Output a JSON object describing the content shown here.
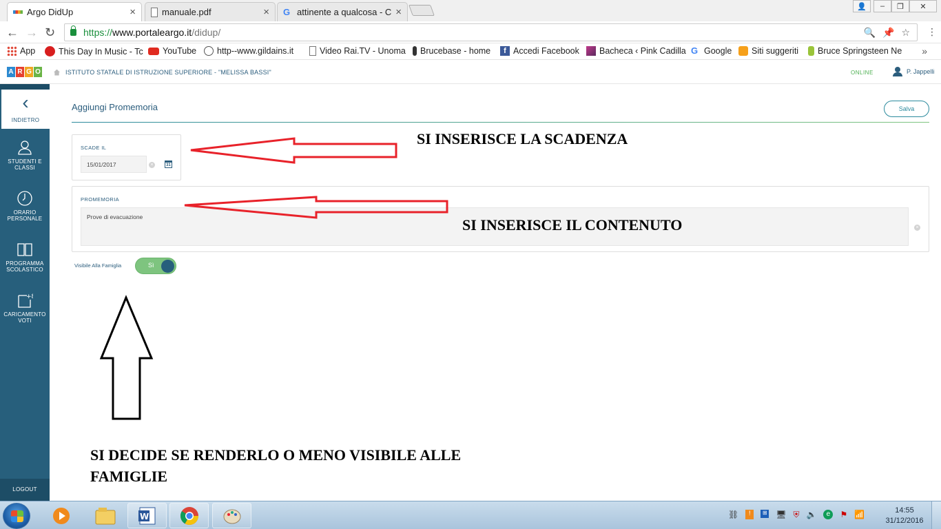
{
  "browser": {
    "tabs": [
      {
        "title": "Argo DidUp",
        "close": "×",
        "active": true
      },
      {
        "title": "manuale.pdf",
        "close": "×",
        "active": false
      },
      {
        "title": "attinente a qualcosa - Ce",
        "close": "×",
        "active": false
      }
    ],
    "url": {
      "protocol": "https://",
      "host": "www.portaleargo.it",
      "path": "/didup/"
    },
    "window_controls": [
      "–",
      "❐",
      "✕"
    ]
  },
  "bookmarks": [
    {
      "label": "App",
      "icon": "apps-grid-icon"
    },
    {
      "label": "This Day In Music - Tc",
      "icon": "red-circle-icon"
    },
    {
      "label": "YouTube",
      "icon": "youtube-icon"
    },
    {
      "label": "http--www.gildains.it",
      "icon": "gildains-icon"
    },
    {
      "label": "Video Rai.TV - Unoma",
      "icon": "page-icon"
    },
    {
      "label": "Brucebase - home",
      "icon": "guitarist-icon"
    },
    {
      "label": "Accedi  Facebook",
      "icon": "facebook-icon"
    },
    {
      "label": "Bacheca ‹ Pink Cadilla",
      "icon": "pink-icon"
    },
    {
      "label": "Google",
      "icon": "google-icon"
    },
    {
      "label": "Siti suggeriti",
      "icon": "suggested-icon"
    },
    {
      "label": "Bruce Springsteen  Ne",
      "icon": "springsteen-icon"
    }
  ],
  "bookmarks_more": "»",
  "app": {
    "logo": [
      "A",
      "R",
      "G",
      "O"
    ],
    "school": "ISTITUTO STATALE DI ISTRUZIONE SUPERIORE - \"MELISSA BASSI\"",
    "status": "ONLINE",
    "user": "P. Jappelli"
  },
  "sidebar": {
    "back": {
      "chevron": "‹",
      "label": "INDIETRO"
    },
    "items": [
      {
        "label1": "STUDENTI E",
        "label2": "CLASSI",
        "icon": "students-icon"
      },
      {
        "label1": "ORARIO",
        "label2": "PERSONALE",
        "icon": "clock-icon"
      },
      {
        "label1": "PROGRAMMA",
        "label2": "SCOLASTICO",
        "icon": "book-icon"
      },
      {
        "label1": "CARICAMENTO",
        "label2": "VOTI",
        "icon": "grades-icon"
      }
    ],
    "logout": "LOGOUT"
  },
  "form": {
    "title": "Aggiungi Promemoria",
    "save": "Salva",
    "due_label": "SCADE IL",
    "due_value": "15/01/2017",
    "calendar_day": "31",
    "memo_label": "PROMEMORIA",
    "memo_value": "Prove di evacuazione",
    "visible_label": "Visibile Alla Famiglia",
    "visible_toggle": "Sì",
    "visible_on": true
  },
  "annotations": {
    "due": "SI INSERISCE LA SCADENZA",
    "content": "SI INSERISCE IL CONTENUTO",
    "visibility_line1": "SI DECIDE SE RENDERLO O MENO VISIBILE ALLE",
    "visibility_line2": "FAMIGLIE"
  },
  "taskbar": {
    "clock_time": "14:55",
    "clock_date": "31/12/2016",
    "pinned": [
      "media-player-icon",
      "explorer-icon",
      "word-icon",
      "chrome-icon",
      "paint-icon"
    ]
  }
}
